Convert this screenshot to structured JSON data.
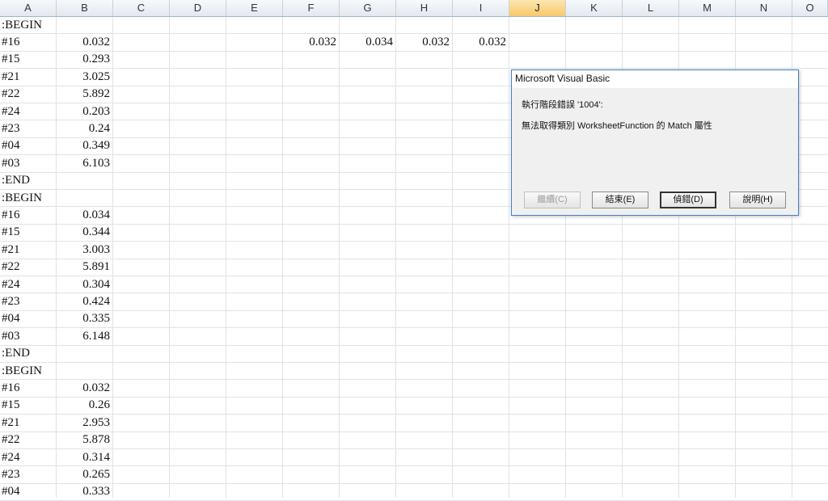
{
  "sheet": {
    "columns": [
      "A",
      "B",
      "C",
      "D",
      "E",
      "F",
      "G",
      "H",
      "I",
      "J",
      "K",
      "L",
      "M",
      "N",
      "O"
    ],
    "selected_column": "J",
    "rows": [
      {
        "a": ":BEGIN",
        "b": ""
      },
      {
        "a": "#16",
        "b": "0.032",
        "f": "0.032",
        "g": "0.034",
        "h": "0.032",
        "i": "0.032"
      },
      {
        "a": "#15",
        "b": "0.293"
      },
      {
        "a": "#21",
        "b": "3.025"
      },
      {
        "a": "#22",
        "b": "5.892"
      },
      {
        "a": "#24",
        "b": "0.203"
      },
      {
        "a": "#23",
        "b": "0.24"
      },
      {
        "a": "#04",
        "b": "0.349"
      },
      {
        "a": "#03",
        "b": "6.103"
      },
      {
        "a": ":END",
        "b": ""
      },
      {
        "a": ":BEGIN",
        "b": ""
      },
      {
        "a": "#16",
        "b": "0.034"
      },
      {
        "a": "#15",
        "b": "0.344"
      },
      {
        "a": "#21",
        "b": "3.003"
      },
      {
        "a": "#22",
        "b": "5.891"
      },
      {
        "a": "#24",
        "b": "0.304"
      },
      {
        "a": "#23",
        "b": "0.424"
      },
      {
        "a": "#04",
        "b": "0.335"
      },
      {
        "a": "#03",
        "b": "6.148"
      },
      {
        "a": ":END",
        "b": ""
      },
      {
        "a": ":BEGIN",
        "b": ""
      },
      {
        "a": "#16",
        "b": "0.032"
      },
      {
        "a": "#15",
        "b": "0.26"
      },
      {
        "a": "#21",
        "b": "2.953"
      },
      {
        "a": "#22",
        "b": "5.878"
      },
      {
        "a": "#24",
        "b": "0.314"
      },
      {
        "a": "#23",
        "b": "0.265"
      },
      {
        "a": "#04",
        "b": "0.333"
      }
    ]
  },
  "dialog": {
    "title": "Microsoft Visual Basic",
    "error_line": "執行階段錯誤 '1004':",
    "message": "無法取得類別 WorksheetFunction 的 Match 屬性",
    "buttons": {
      "continue": "繼續(C)",
      "end": "結束(E)",
      "debug": "偵錯(D)",
      "help": "說明(H)"
    }
  }
}
